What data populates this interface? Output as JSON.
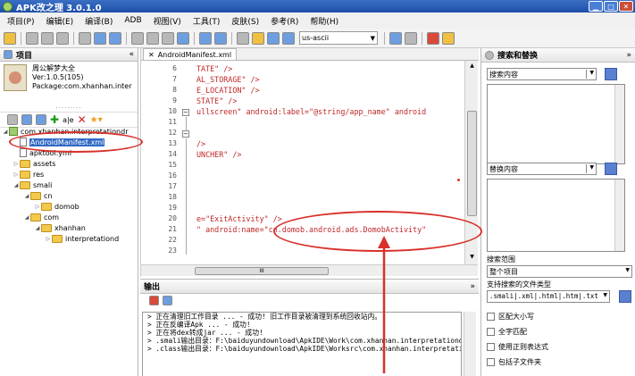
{
  "window": {
    "title": "APK改之理 3.0.1.0"
  },
  "menu": [
    "项目(P)",
    "编辑(E)",
    "编译(B)",
    "ADB",
    "视图(V)",
    "工具(T)",
    "皮肤(S)",
    "参考(R)",
    "帮助(H)"
  ],
  "toolbar": {
    "encoding": "us-ascii"
  },
  "project_panel": {
    "title": "项目",
    "app_name": "周公解梦大全",
    "version": "Ver:1.0.5(105)",
    "package": "Package:com.xhanhan.inter"
  },
  "tree": [
    {
      "label": "com.xhanhan.interpretationdr",
      "type": "project"
    },
    {
      "label": "AndroidManifest.xml",
      "type": "file",
      "selected": true
    },
    {
      "label": "apktool.yml",
      "type": "file"
    },
    {
      "label": "assets",
      "type": "folder"
    },
    {
      "label": "res",
      "type": "folder"
    },
    {
      "label": "smali",
      "type": "folder"
    },
    {
      "label": "cn",
      "type": "folder"
    },
    {
      "label": "domob",
      "type": "folder"
    },
    {
      "label": "com",
      "type": "folder"
    },
    {
      "label": "xhanhan",
      "type": "folder"
    },
    {
      "label": "interpretationd",
      "type": "folder"
    }
  ],
  "editor": {
    "tab": "AndroidManifest.xml",
    "lines": [
      {
        "n": "6",
        "text": "TATE\" />"
      },
      {
        "n": "7",
        "text": "AL_STORAGE\" />"
      },
      {
        "n": "8",
        "text": "E_LOCATION\" />"
      },
      {
        "n": "9",
        "text": "STATE\" />"
      },
      {
        "n": "10",
        "text": "ullscreen\" android:label=\"@string/app_name\" android"
      },
      {
        "n": "11",
        "text": ""
      },
      {
        "n": "12",
        "text": ""
      },
      {
        "n": "13",
        "text": "/>"
      },
      {
        "n": "14",
        "text": "UNCHER\" />"
      },
      {
        "n": "15",
        "text": ""
      },
      {
        "n": "16",
        "text": ""
      },
      {
        "n": "17",
        "text": ""
      },
      {
        "n": "18",
        "text": ""
      },
      {
        "n": "19",
        "text": ""
      },
      {
        "n": "20",
        "text": "e=\"ExitActivity\" />"
      },
      {
        "n": "21",
        "text": "\" android:name=\"cn.domob.android.ads.DomobActivity\""
      },
      {
        "n": "22",
        "text": ""
      },
      {
        "n": "23",
        "text": ""
      }
    ],
    "hscroll_label": "III"
  },
  "output": {
    "title": "输出",
    "lines": [
      "> 正在清理旧工作目录 ... - 成功! 旧工作目录被清理到系统回收站内。",
      "> 正在反编译Apk ... - 成功!",
      "> 正在将dex转成jar ... - 成功!",
      "> .smali输出目录：F:\\baiduyundownload\\ApkIDE\\Work\\com.xhanhan.interpretationdre",
      "> .class输出目录：F:\\baiduyundownload\\ApkIDE\\Worksrc\\com.xhanhan.interpretatio"
    ]
  },
  "search_panel": {
    "title": "搜索和替换",
    "search_label": "搜索内容",
    "replace_label": "替换内容",
    "scope_label": "搜索范围",
    "scope_value": "整个项目",
    "types_label": "支持搜索的文件类型",
    "types_value": ".smali|.xml|.html|.htm|.txt",
    "checks": [
      "区配大小写",
      "全字匹配",
      "使用正则表达式",
      "包括子文件夹"
    ]
  }
}
